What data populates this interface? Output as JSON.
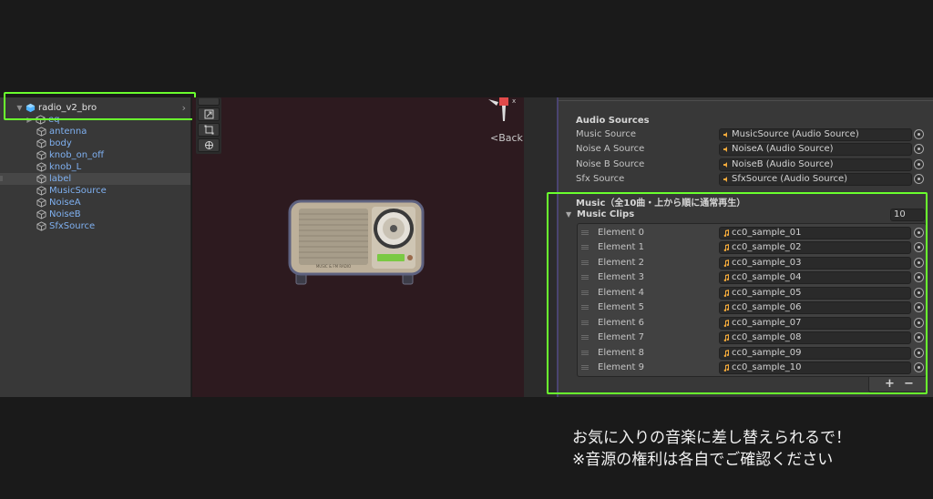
{
  "hierarchy": {
    "root": "radio_v2_bro",
    "children": [
      "eq",
      "antenna",
      "body",
      "knob_on_off",
      "knob_L",
      "label",
      "MusicSource",
      "NoiseA",
      "NoiseB",
      "SfxSource"
    ]
  },
  "scene": {
    "back_label": "<Back",
    "radio_label": "MUSIC & FM RADIO"
  },
  "inspector": {
    "audio_sources_header": "Audio Sources",
    "properties": [
      {
        "label": "Music Source",
        "value": "MusicSource (Audio Source)"
      },
      {
        "label": "Noise A Source",
        "value": "NoiseA (Audio Source)"
      },
      {
        "label": "Noise B Source",
        "value": "NoiseB (Audio Source)"
      },
      {
        "label": "Sfx Source",
        "value": "SfxSource (Audio Source)"
      }
    ],
    "music_header": "Music（全10曲・上から順に通常再生）",
    "music_clips_label": "Music Clips",
    "music_clips_size": "10",
    "elements": [
      {
        "label": "Element 0",
        "value": "cc0_sample_01"
      },
      {
        "label": "Element 1",
        "value": "cc0_sample_02"
      },
      {
        "label": "Element 2",
        "value": "cc0_sample_03"
      },
      {
        "label": "Element 3",
        "value": "cc0_sample_04"
      },
      {
        "label": "Element 4",
        "value": "cc0_sample_05"
      },
      {
        "label": "Element 5",
        "value": "cc0_sample_06"
      },
      {
        "label": "Element 6",
        "value": "cc0_sample_07"
      },
      {
        "label": "Element 7",
        "value": "cc0_sample_08"
      },
      {
        "label": "Element 8",
        "value": "cc0_sample_09"
      },
      {
        "label": "Element 9",
        "value": "cc0_sample_10"
      }
    ],
    "add_label": "+",
    "remove_label": "−"
  },
  "caption": {
    "line1": "お気に入りの音楽に差し替えられるで！",
    "line2": "※音源の権利は各自でご確認ください"
  },
  "colors": {
    "highlight": "#6aff2e",
    "hierarchy_child_text": "#7fb0f0",
    "scene_background": "#2d1a1f",
    "audio_icon": "#f2a93b"
  },
  "icons": [
    "gameobject-icon",
    "prefab-icon",
    "audio-source-icon",
    "audio-clip-icon",
    "object-picker-icon"
  ]
}
